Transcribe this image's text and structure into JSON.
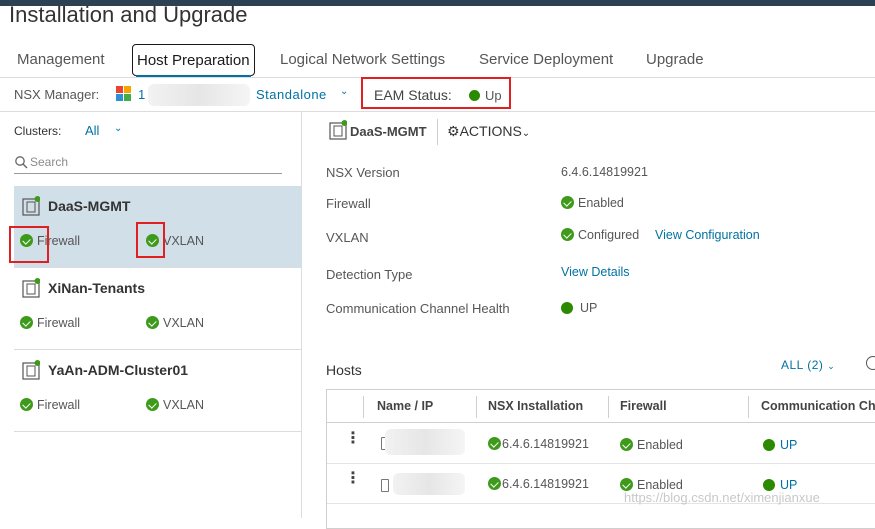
{
  "page": {
    "title": "Installation and Upgrade"
  },
  "tabs": [
    {
      "label": "Management"
    },
    {
      "label": "Host Preparation",
      "active": true
    },
    {
      "label": "Logical Network Settings"
    },
    {
      "label": "Service Deployment"
    },
    {
      "label": "Upgrade"
    }
  ],
  "manager": {
    "label": "NSX Manager:",
    "ip_visible": "1",
    "mode": "Standalone",
    "eam_label": "EAM Status:",
    "eam_value": "Up",
    "eam_color": "#2b8a00"
  },
  "clusters": {
    "label": "Clusters:",
    "filter": "All",
    "search_placeholder": "Search",
    "items": [
      {
        "name": "DaaS-MGMT",
        "firewall": "Firewall",
        "vxlan": "VXLAN",
        "selected": true
      },
      {
        "name": "XiNan-Tenants",
        "firewall": "Firewall",
        "vxlan": "VXLAN"
      },
      {
        "name": "YaAn-ADM-Cluster01",
        "firewall": "Firewall",
        "vxlan": "VXLAN"
      }
    ]
  },
  "detail": {
    "name": "DaaS-MGMT",
    "actions": "ACTIONS",
    "props": {
      "nsx_version_label": "NSX Version",
      "nsx_version_value": "6.4.6.14819921",
      "firewall_label": "Firewall",
      "firewall_value": "Enabled",
      "vxlan_label": "VXLAN",
      "vxlan_value": "Configured",
      "vxlan_link": "View Configuration",
      "detection_label": "Detection Type",
      "detection_link": "View Details",
      "comm_label": "Communication Channel Health",
      "comm_value": "UP"
    }
  },
  "hosts": {
    "title": "Hosts",
    "filter": "ALL (2)",
    "columns": [
      "Name / IP",
      "NSX Installation",
      "Firewall",
      "Communication Ch"
    ],
    "rows": [
      {
        "nsx": "6.4.6.14819921",
        "firewall": "Enabled",
        "comm": "UP"
      },
      {
        "nsx": "6.4.6.14819921",
        "firewall": "Enabled",
        "comm": "UP"
      }
    ]
  },
  "watermark": "https://blog.csdn.net/ximenjianxue",
  "colors": {
    "accent": "#0072a3",
    "success": "#3d9a1a",
    "highlight": "#e02020",
    "selected_bg": "#d0dfe8"
  }
}
